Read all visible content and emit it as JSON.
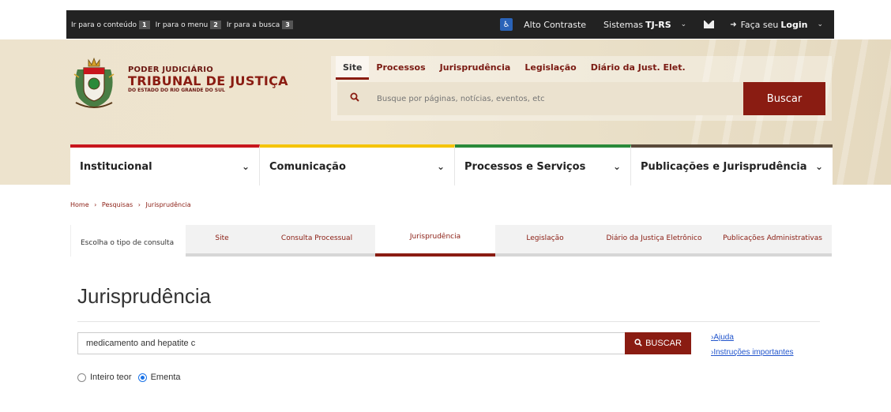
{
  "topbar": {
    "skip_links": [
      {
        "label": "Ir para o conteúdo",
        "num": "1"
      },
      {
        "label": "Ir para o menu",
        "num": "2"
      },
      {
        "label": "Ir para a busca",
        "num": "3"
      }
    ],
    "contrast": "Alto Contraste",
    "sistemas": "Sistemas",
    "sistemas_bold": "TJ-RS",
    "login_prefix": "Faça seu",
    "login_bold": "Login"
  },
  "logo": {
    "line1": "PODER JUDICIÁRIO",
    "line2": "TRIBUNAL DE JUSTIÇA",
    "line3": "DO ESTADO DO RIO GRANDE DO SUL"
  },
  "header_search": {
    "tabs": [
      "Site",
      "Processos",
      "Jurisprudência",
      "Legislação",
      "Diário da Just. Elet."
    ],
    "placeholder": "Busque por páginas, notícias, eventos, etc",
    "button": "Buscar"
  },
  "mainnav": [
    {
      "label": "Institucional",
      "color": "#c8161d"
    },
    {
      "label": "Comunicação",
      "color": "#f5c400"
    },
    {
      "label": "Processos e Serviços",
      "color": "#2a8a3a"
    },
    {
      "label": "Publicações e Jurisprudência",
      "color": "#5a4a3a"
    }
  ],
  "breadcrumb": [
    "Home",
    "›",
    "Pesquisas",
    "›",
    "Jurisprudência"
  ],
  "consulta": {
    "label": "Escolha o tipo de consulta",
    "tabs": [
      "Site",
      "Consulta Processual",
      "Jurisprudência",
      "Legislação",
      "Diário da Justiça Eletrônico",
      "Publicações Administrativas"
    ]
  },
  "page": {
    "title": "Jurisprudência",
    "query": "medicamento and hepatite c",
    "button": "BUSCAR",
    "help": [
      "Ajuda",
      "Instruções importantes"
    ],
    "radios": [
      "Inteiro teor",
      "Ementa"
    ]
  },
  "colors": {
    "brand": "#8a1c12",
    "topbar": "#222222"
  }
}
